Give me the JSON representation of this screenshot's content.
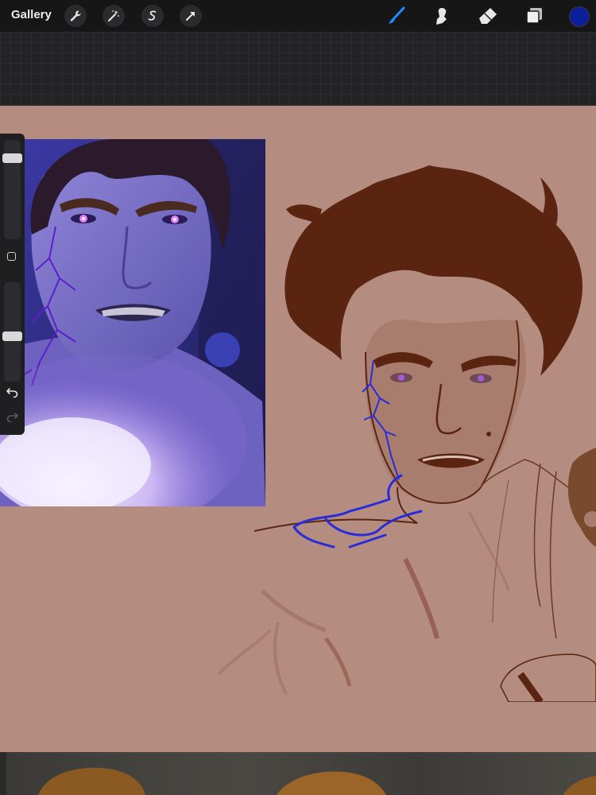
{
  "toolbar": {
    "gallery_label": "Gallery",
    "left_tools": [
      "wrench-icon",
      "magic-wand-icon",
      "selection-icon",
      "transform-arrow-icon"
    ],
    "right_tools": [
      "brush-icon",
      "smudge-icon",
      "eraser-icon",
      "layers-icon"
    ],
    "active_tool": "brush-icon",
    "active_color": "#0b1f9c",
    "accent_color": "#1f8bff"
  },
  "sidebar": {
    "brush_size_level": 0.85,
    "opacity_level": 0.45,
    "buttons": [
      "modify-button",
      "undo-icon",
      "redo-icon"
    ]
  },
  "canvas": {
    "background_color": "#b48d80",
    "sketch_color": "#5a2410",
    "vein_color": "#2a2bd9"
  }
}
